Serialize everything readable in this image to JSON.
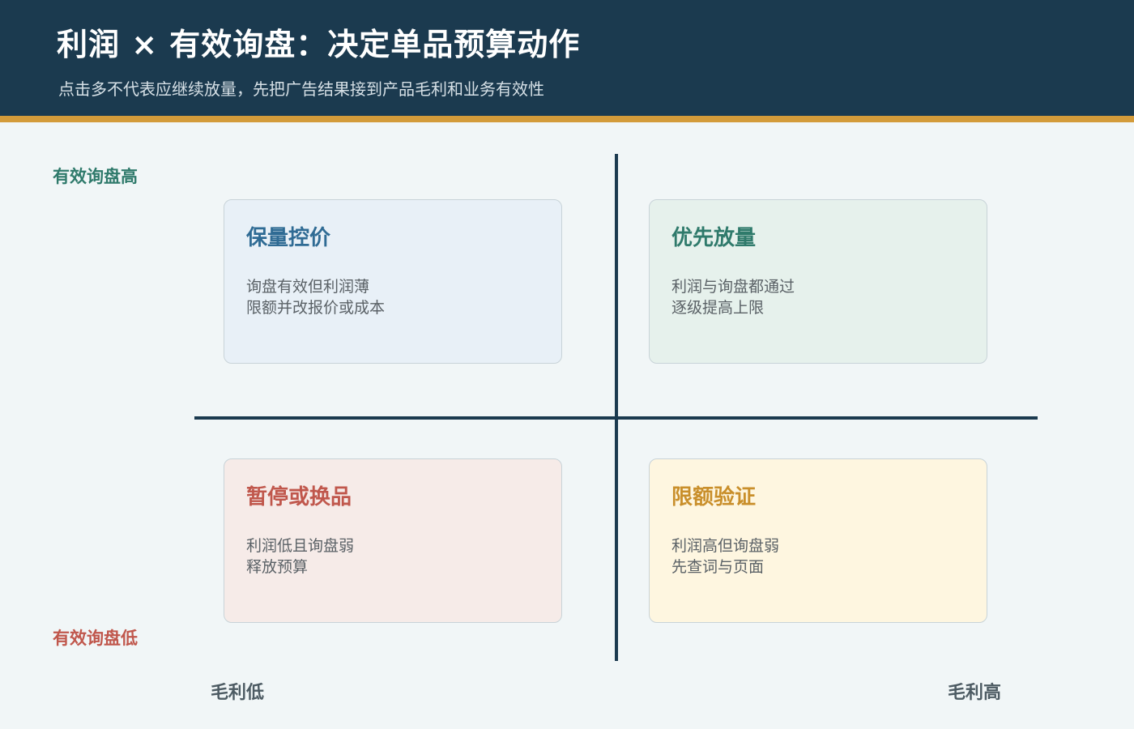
{
  "header": {
    "title": "利润 × 有效询盘：决定单品预算动作",
    "subtitle": "点击多不代表应继续放量，先把广告结果接到产品毛利和业务有效性"
  },
  "axes": {
    "y_high": "有效询盘高",
    "y_low": "有效询盘低",
    "x_low": "毛利低",
    "x_high": "毛利高"
  },
  "quadrants": {
    "top_left": {
      "title": "保量控价",
      "lines": [
        "询盘有效但利润薄",
        "限额并改报价或成本"
      ],
      "color": "#2f6b94"
    },
    "top_right": {
      "title": "优先放量",
      "lines": [
        "利润与询盘都通过",
        "逐级提高上限"
      ],
      "color": "#2f7a6b"
    },
    "bottom_left": {
      "title": "暂停或换品",
      "lines": [
        "利润低且询盘弱",
        "释放预算"
      ],
      "color": "#c0574c"
    },
    "bottom_right": {
      "title": "限额验证",
      "lines": [
        "利润高但询盘弱",
        "先查词与页面"
      ],
      "color": "#c98f2b"
    }
  },
  "colors": {
    "header_bg": "#1b3a4f",
    "accent_bar": "#d39b3a",
    "axis": "#1b3a4f"
  }
}
